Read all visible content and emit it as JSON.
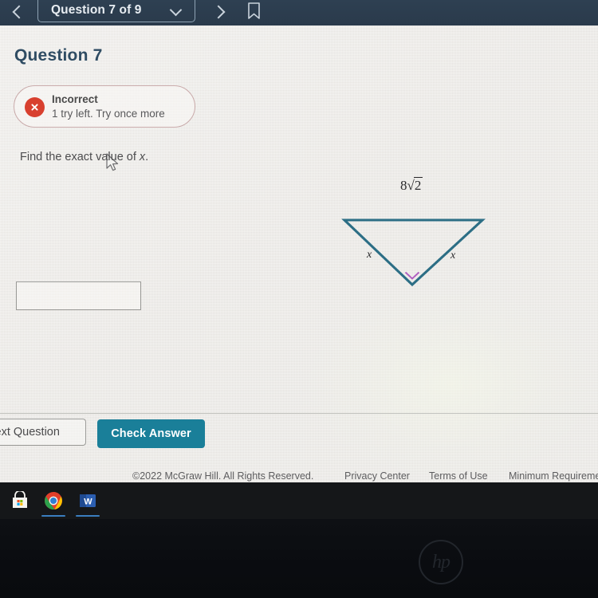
{
  "navbar": {
    "back_icon": "chevron-left-icon",
    "forward_icon": "chevron-right-icon",
    "question_selector_label": "Question 7 of 9",
    "dropdown_icon": "chevron-down-icon",
    "bookmark_icon": "bookmark-icon"
  },
  "page": {
    "title": "Question 7",
    "prompt_prefix": "Find the exact value of ",
    "prompt_variable": "x",
    "prompt_suffix": "."
  },
  "alert": {
    "icon": "error-x-icon",
    "title": "Incorrect",
    "subtitle": "1 try left. Try once more",
    "border_color": "#c8a9a9",
    "icon_color": "#d8402f"
  },
  "answer_input": {
    "value": "",
    "placeholder": ""
  },
  "figure": {
    "type": "triangle",
    "description": "isosceles right triangle pointing downward",
    "hypotenuse_label_coefficient": "8",
    "hypotenuse_label_radicand": "2",
    "left_leg_label": "x",
    "right_leg_label": "x",
    "right_angle_marker": "right-angle-marker",
    "stroke_color": "#2c6e85",
    "marker_color": "#b05fc0"
  },
  "buttons": {
    "next_question": "Next Question",
    "check_answer": "Check Answer",
    "check_answer_color": "#1a7f99"
  },
  "footer": {
    "copyright": "©2022 McGraw Hill. All Rights Reserved.",
    "links": [
      "Privacy Center",
      "Terms of Use",
      "Minimum Requiremen"
    ]
  },
  "taskbar": {
    "items": [
      {
        "icon": "microsoft-store-icon",
        "running": false
      },
      {
        "icon": "chrome-icon",
        "running": true
      },
      {
        "icon": "word-icon",
        "running": true
      }
    ]
  },
  "bezel": {
    "logo_text": "hp"
  },
  "cursor": {
    "icon": "mouse-pointer-icon"
  }
}
